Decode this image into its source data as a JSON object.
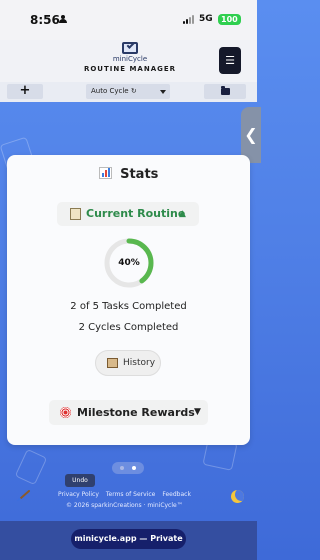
{
  "status_bar": {
    "time": "8:56",
    "network": "5G",
    "battery": "100"
  },
  "header": {
    "app_title": "miniCycle",
    "subtitle": "ROUTINE MANAGER",
    "menu_icon": "hamburger-icon"
  },
  "toolbar": {
    "add_label": "+",
    "cycle_select_value": "Auto Cycle ↻",
    "folder_icon": "folder-icon"
  },
  "side_handle": {
    "label": "❮"
  },
  "stats": {
    "title": "Stats",
    "routine_section": {
      "label": "Current Routine",
      "toggle": "▲"
    },
    "progress": {
      "value_percent": 40,
      "label": "40%",
      "color": "#59b84f",
      "track_color": "#e6e6e6"
    },
    "tasks_completed_text": "2 of 5 Tasks Completed",
    "cycles_completed_text": "2 Cycles Completed",
    "history_button": "History",
    "milestone_section": {
      "label": "Milestone Rewards",
      "toggle": "▼"
    }
  },
  "pager": {
    "dots": 2,
    "active_index": 1
  },
  "undo_label": "Undo",
  "footer": {
    "links": [
      "Privacy Policy",
      "Terms of Service",
      "Feedback"
    ],
    "copyright": "© 2026 sparkinCreations · miniCycle™"
  },
  "browser": {
    "url_label": "minicycle.app — Private"
  },
  "colors": {
    "background": "#5a8ef0",
    "accent_green": "#2e8b4b",
    "menu_button": "#15192a",
    "url_pill": "#16206b"
  }
}
